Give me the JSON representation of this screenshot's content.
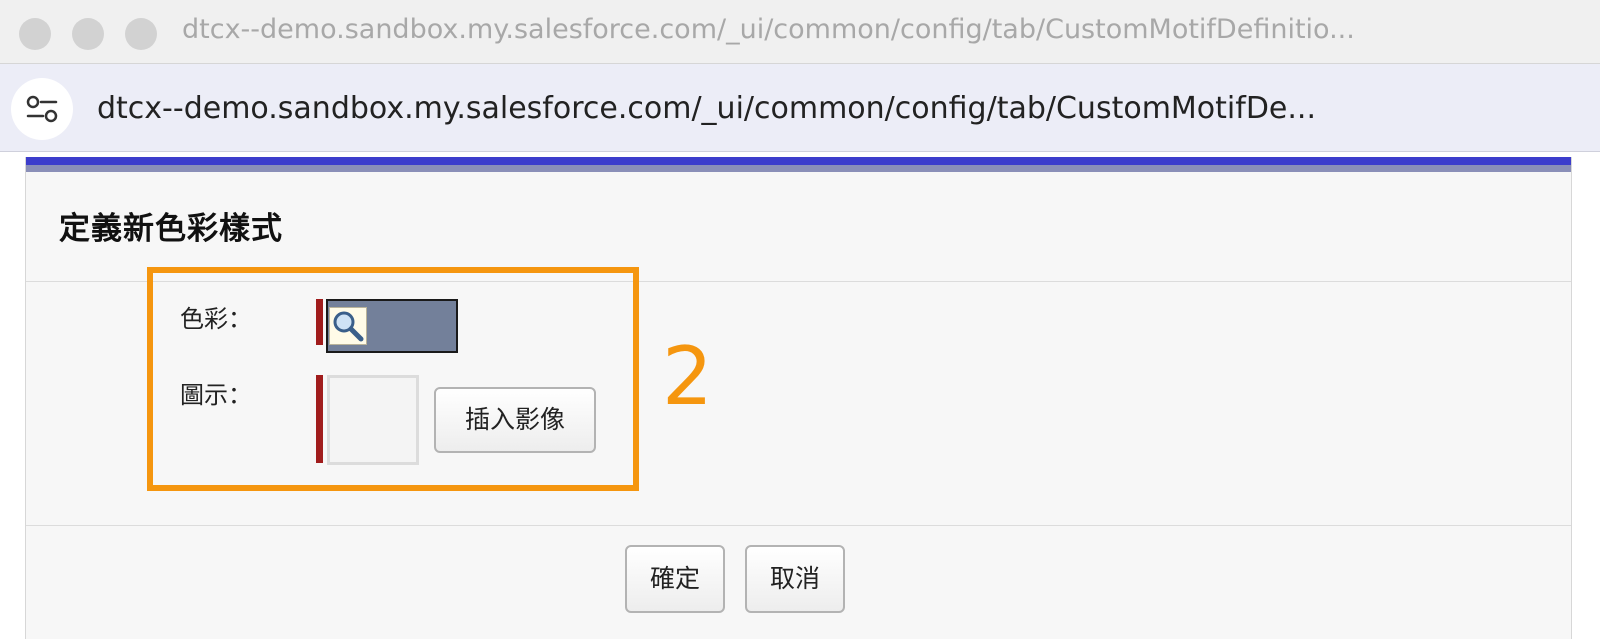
{
  "browser": {
    "title_url": "dtcx--demo.sandbox.my.salesforce.com/_ui/common/config/tab/CustomMotifDefinitio...",
    "address_url": "dtcx--demo.sandbox.my.salesforce.com/_ui/common/config/tab/CustomMotifDe...",
    "site_icon": "site-settings-icon"
  },
  "form": {
    "title": "定義新色彩樣式",
    "color_label": "色彩：",
    "icon_label": "圖示：",
    "color_value_icon": "lookup-icon",
    "insert_image_label": "插入影像",
    "ok_label": "確定",
    "cancel_label": "取消"
  },
  "annotation": {
    "step_number": "2",
    "color": "#f5960f"
  },
  "colors": {
    "accent_bar": "#3c3dcc",
    "required_marker": "#a01c1c",
    "color_swatch": "#73809a"
  }
}
